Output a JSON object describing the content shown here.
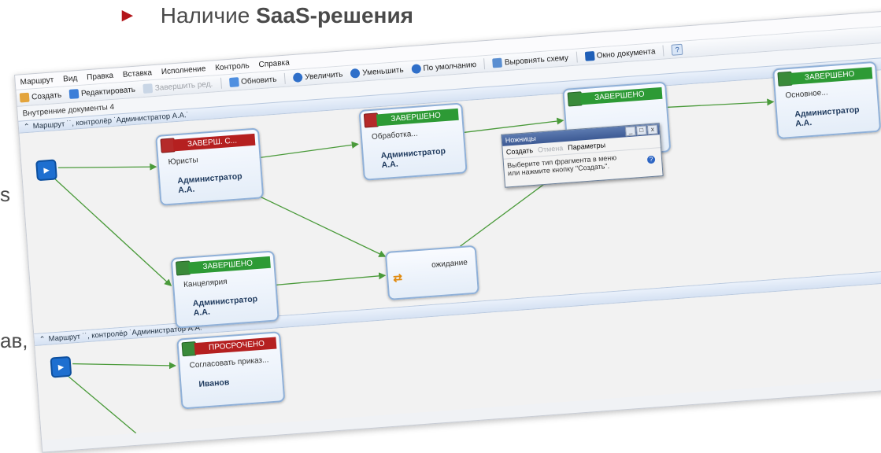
{
  "slide": {
    "title_prefix": "Наличие ",
    "title_bold": "SaaS-решения",
    "left_fragments": [
      "s",
      "ав,"
    ]
  },
  "menubar": [
    "Маршрут",
    "Вид",
    "Правка",
    "Вставка",
    "Исполнение",
    "Контроль",
    "Справка"
  ],
  "toolbar": {
    "create": "Создать",
    "edit": "Редактировать",
    "finish": "Завершить ред.",
    "refresh": "Обновить",
    "zoom_in": "Увеличить",
    "zoom_out": "Уменьшить",
    "zoom_default": "По умолчанию",
    "align": "Выровнять схему",
    "doc_window": "Окно документа",
    "help": "?"
  },
  "subbar": "Внутренние документы 4",
  "route1": {
    "header": "Маршрут ˙˙, контролёр ˙Администратор А.А.˙",
    "start": "▸",
    "tasks": [
      {
        "status": "ЗАВЕРШ. С...",
        "type": "late",
        "stage": "Юристы",
        "owner": "Администратор А.А."
      },
      {
        "status": "ЗАВЕРШЕНО",
        "type": "done",
        "stage": "Обработка...",
        "owner": "Администратор А.А."
      },
      {
        "status": "ЗАВЕРШЕНО",
        "type": "done",
        "stage": "",
        "owner": ""
      },
      {
        "status": "ЗАВЕРШЕНО",
        "type": "done",
        "stage": "Основное...",
        "owner": "Администратор А.А."
      },
      {
        "status": "ЗАВЕРШЕНО",
        "type": "done",
        "stage": "Канцелярия",
        "owner": "Администратор А.А."
      }
    ],
    "wait_label": "ожидание"
  },
  "route2": {
    "header": "Маршрут ˙˙, контролёр ˙Администратор А.А.˙",
    "tasks": [
      {
        "status": "ПРОСРОЧЕНО",
        "type": "late",
        "stage": "Согласовать приказ...",
        "owner": "Иванов"
      }
    ]
  },
  "snip": {
    "title": "Ножницы",
    "new": "Создать",
    "cancel": "Отмена",
    "options": "Параметры",
    "hint": "Выберите тип фрагмента в меню или нажмите кнопку \"Создать\"."
  },
  "colors": {
    "done": "#2d9a35",
    "late": "#b52020",
    "edge": "#4a9a3a",
    "accent": "#b3161b"
  }
}
